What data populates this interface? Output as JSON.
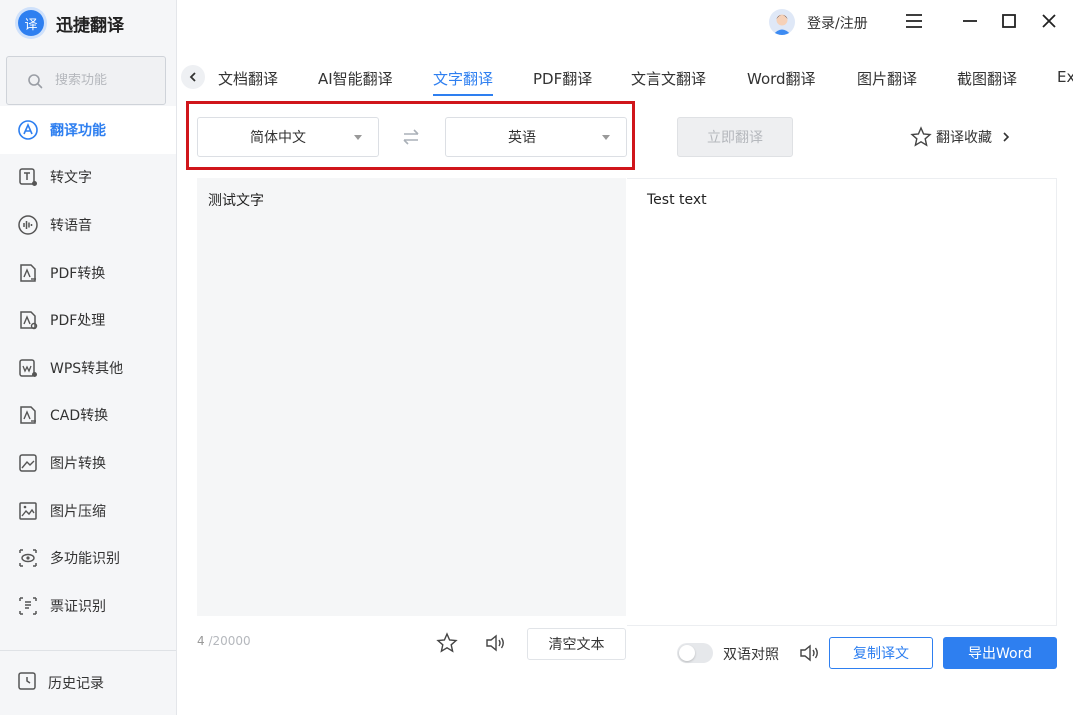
{
  "app": {
    "name": "迅捷翻译",
    "logo_glyph": "译",
    "accent": "#2e7ff0",
    "highlight_color": "#d0161b"
  },
  "search": {
    "placeholder": "搜索功能",
    "icon": "search-icon"
  },
  "sidebar": {
    "items": [
      {
        "label": "翻译功能",
        "icon": "translate-icon",
        "active": true
      },
      {
        "label": "转文字",
        "icon": "text-convert-icon"
      },
      {
        "label": "转语音",
        "icon": "voice-icon"
      },
      {
        "label": "PDF转换",
        "icon": "pdf-convert-icon"
      },
      {
        "label": "PDF处理",
        "icon": "pdf-process-icon"
      },
      {
        "label": "WPS转其他",
        "icon": "wps-icon"
      },
      {
        "label": "CAD转换",
        "icon": "cad-icon"
      },
      {
        "label": "图片转换",
        "icon": "image-convert-icon"
      },
      {
        "label": "图片压缩",
        "icon": "image-compress-icon"
      },
      {
        "label": "多功能识别",
        "icon": "eye-icon"
      },
      {
        "label": "票证识别",
        "icon": "ticket-scan-icon"
      }
    ],
    "history": {
      "label": "历史记录",
      "icon": "history-icon"
    }
  },
  "header": {
    "login_label": "登录/注册"
  },
  "tabs": [
    {
      "label": "文档翻译"
    },
    {
      "label": "AI智能翻译"
    },
    {
      "label": "文字翻译",
      "active": true
    },
    {
      "label": "PDF翻译"
    },
    {
      "label": "文言文翻译"
    },
    {
      "label": "Word翻译"
    },
    {
      "label": "图片翻译"
    },
    {
      "label": "截图翻译"
    },
    {
      "label": "Ex"
    }
  ],
  "language": {
    "source": "简体中文",
    "target": "英语",
    "translate_button": "立即翻译",
    "favorites_label": "翻译收藏"
  },
  "editor": {
    "source_text": "测试文字",
    "target_text": "Test text",
    "char_count": "4",
    "char_max": "/20000",
    "clear_label": "清空文本"
  },
  "output": {
    "bilingual_label": "双语对照",
    "bilingual_on": false,
    "copy_label": "复制译文",
    "export_label": "导出Word"
  }
}
